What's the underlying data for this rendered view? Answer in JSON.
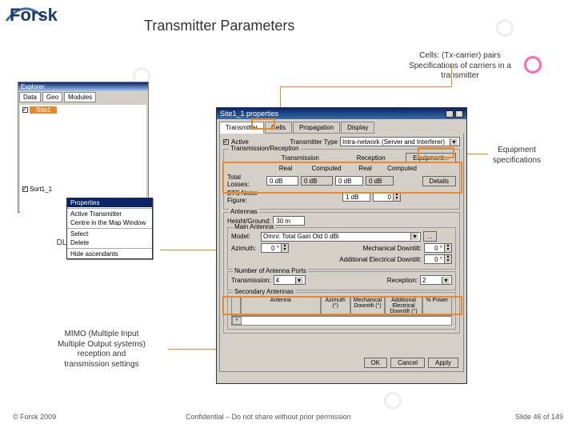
{
  "header": {
    "logo": "Forsk",
    "title": "Transmitter Parameters"
  },
  "annotations": {
    "cells": "Cells: (Tx-carrier) pairs\nSpecifications of carriers in a\ntransmitter",
    "equipment": "Equipment\nspecifications",
    "dlul": "DL and UL total losses,\nnoise figure",
    "mimo": "MIMO (Multiple Input\nMultiple Output systems)\nreception and\ntransmission settings"
  },
  "footer": {
    "left": "© Forsk 2009",
    "center": "Confidential – Do not share without prior permission",
    "right": "Slide 46 of 149"
  },
  "explorer": {
    "title": "Explorer",
    "tabs": [
      "Data",
      "Geo",
      "Modules"
    ],
    "items": [
      "Site1",
      "Active Transmitter",
      "Centre in the Map Window",
      "Select",
      "Delete",
      "Hide ascendants",
      "Sort1_1"
    ],
    "context": {
      "items": [
        "Properties",
        "Active Transmitter",
        "Centre in the Map Window",
        "Select",
        "Delete",
        "Hide ascendants"
      ],
      "selected": "Properties"
    }
  },
  "dialog": {
    "title": "Site1_1 properties",
    "close_label": "X",
    "tabs": [
      "Transmitter",
      "Cells",
      "Propagation",
      "Display"
    ],
    "active_tab": "Transmitter",
    "active_chk": "Active",
    "tx_type_lbl": "Transmitter Type",
    "tx_type_val": "Intra-network (Server and Interferer)",
    "group_tr": "Transmission/Reception",
    "col_tx": "Transmission",
    "col_rx": "Reception",
    "equipment_btn": "Equipment...",
    "row_real": "Real",
    "row_comp": "Computed",
    "row_real2": "Real",
    "row_comp2": "Computed",
    "tl_lbl": "Total Losses:",
    "tl_tx_real": "0 dB",
    "tl_tx_comp": "0 dB",
    "tl_rx_real": "0 dB",
    "tl_rx_comp": "0 dB",
    "details_btn": "Details",
    "nf_lbl": "BTS Noise Figure:",
    "nf_real": "1 dB",
    "nf_comp": "0",
    "group_ant": "Antennas",
    "height_lbl": "Height/Ground:",
    "height_val": "30 m",
    "group_main": "Main Antenna",
    "model_lbl": "Model:",
    "model_val": "Omni: Total Gain Old 0 dBi",
    "model_btn": "...",
    "azimuth_lbl": "Azimuth:",
    "azimuth_val": "0 °",
    "mdt_lbl": "Mechanical Downtilt:",
    "mdt_val": "0 °",
    "aed_lbl": "Additional Electrical Downtilt:",
    "aed_val": "0 °",
    "group_ports": "Number of Antenna Ports",
    "ports_tx_lbl": "Transmission:",
    "ports_tx_val": "4",
    "ports_rx_lbl": "Reception:",
    "ports_rx_val": "2",
    "group_sec": "Secondary Antennas",
    "sec_cols": [
      "Antenna",
      "Azimuth (°)",
      "Mechanical Downtilt (°)",
      "Additional Electrical Downtilt (°)",
      "% Power"
    ],
    "sec_row_star": "*",
    "ok": "OK",
    "cancel": "Cancel",
    "apply": "Apply"
  }
}
